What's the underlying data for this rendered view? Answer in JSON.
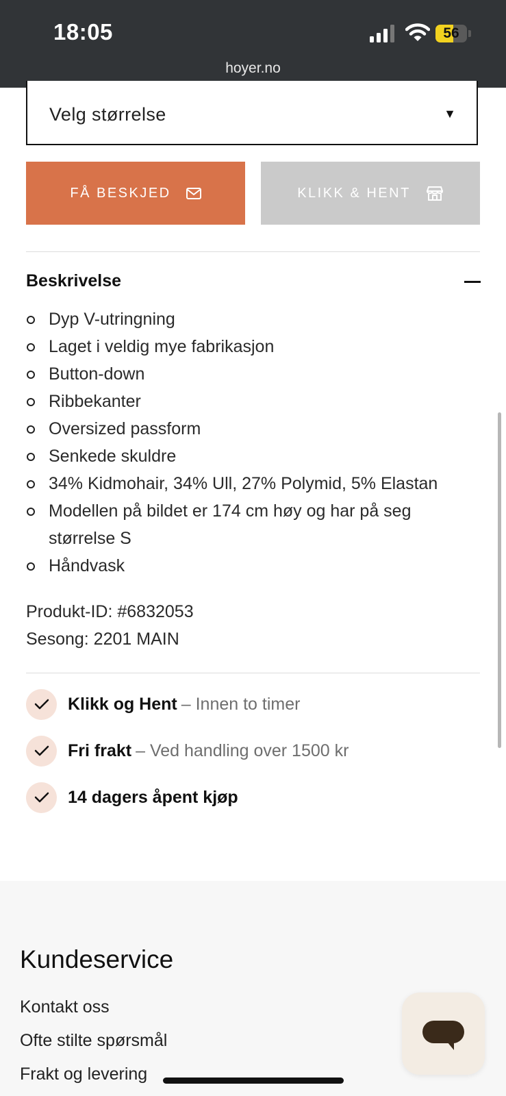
{
  "status_bar": {
    "time": "18:05",
    "battery": "56",
    "url": "hoyer.no"
  },
  "product": {
    "size_select": {
      "label": "Velg størrelse"
    },
    "buttons": {
      "notify": "FÅ BESKJED",
      "click_collect": "KLIKK & HENT"
    },
    "description": {
      "title": "Beskrivelse",
      "items": [
        "Dyp V-utringning",
        "Laget i veldig mye fabrikasjon",
        "Button-down",
        "Ribbekanter",
        "Oversized passform",
        "Senkede skuldre",
        "34% Kidmohair, 34% Ull, 27% Polymid, 5% Elastan",
        "Modellen på bildet er 174 cm høy og har på seg størrelse S",
        "Håndvask"
      ],
      "product_id": "Produkt-ID: #6832053",
      "season": "Sesong: 2201 MAIN"
    },
    "features": [
      {
        "title": "Klikk og Hent",
        "detail": "– Innen to timer"
      },
      {
        "title": "Fri frakt",
        "detail": "– Ved handling over 1500 kr"
      },
      {
        "title": "14 dagers åpent kjøp",
        "detail": ""
      }
    ]
  },
  "footer": {
    "title": "Kundeservice",
    "links": [
      "Kontakt oss",
      "Ofte stilte spørsmål",
      "Frakt og levering"
    ]
  },
  "colors": {
    "accent": "#d8734a",
    "disabled": "#cacaca",
    "check_bg": "#f6e2d9",
    "status_bar": "#313437"
  }
}
